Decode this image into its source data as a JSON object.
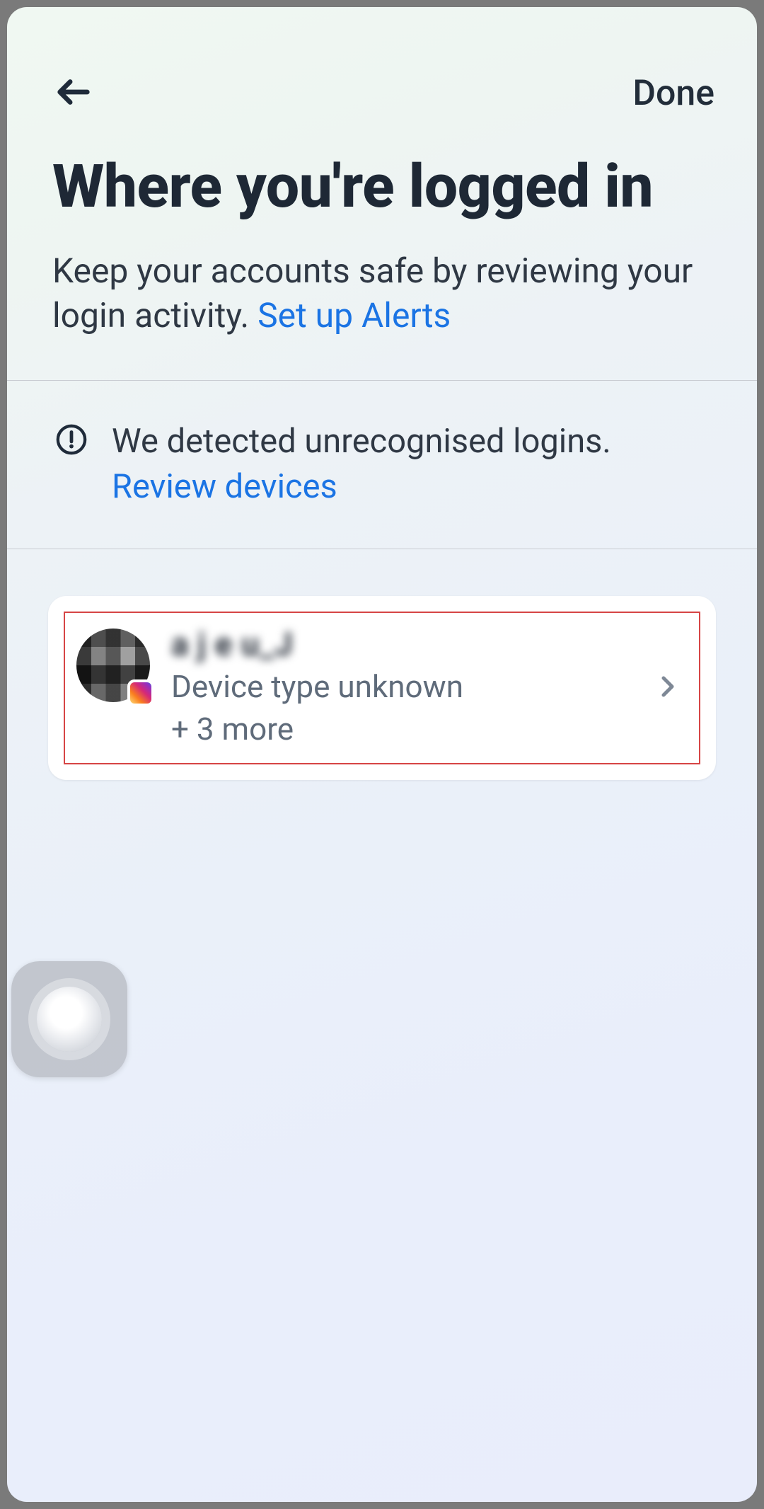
{
  "nav": {
    "done_label": "Done"
  },
  "header": {
    "title": "Where you're logged in",
    "subtitle_text": "Keep your accounts safe by reviewing your login activity. ",
    "subtitle_link": "Set up Alerts"
  },
  "alert": {
    "text": "We detected unrecognised logins. ",
    "link": "Review devices"
  },
  "device": {
    "display_name_obscured": "a j e u_J",
    "type_text": "Device type unknown",
    "more_text": "+ 3 more",
    "app_badge": "instagram"
  }
}
